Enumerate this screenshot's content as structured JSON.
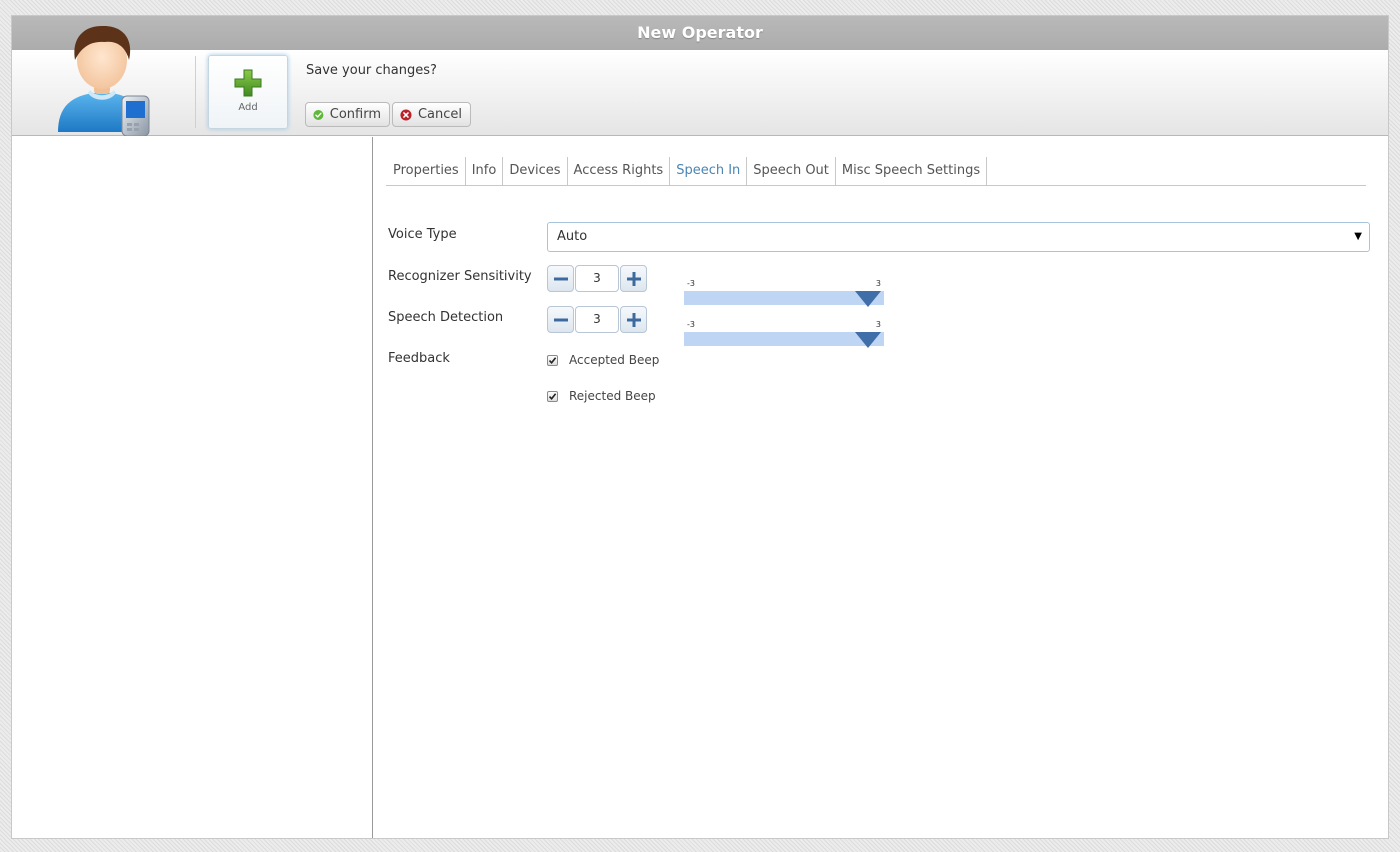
{
  "window": {
    "title": "New Operator"
  },
  "header": {
    "add_label": "Add",
    "prompt": "Save your changes?",
    "confirm_label": "Confirm",
    "cancel_label": "Cancel"
  },
  "tabs": [
    {
      "label": "Properties"
    },
    {
      "label": "Info"
    },
    {
      "label": "Devices"
    },
    {
      "label": "Access Rights"
    },
    {
      "label": "Speech In",
      "active": true
    },
    {
      "label": "Speech Out"
    },
    {
      "label": "Misc Speech Settings"
    }
  ],
  "form": {
    "voice_type": {
      "label": "Voice Type",
      "value": "Auto",
      "arrow": "▼"
    },
    "recognizer_sensitivity": {
      "label": "Recognizer Sensitivity",
      "value": "3",
      "min": "-3",
      "max": "3"
    },
    "speech_detection": {
      "label": "Speech Detection",
      "value": "3",
      "min": "-3",
      "max": "3"
    },
    "feedback": {
      "label": "Feedback",
      "options": [
        {
          "label": "Accepted Beep",
          "checked": true
        },
        {
          "label": "Rejected Beep",
          "checked": true
        }
      ]
    }
  },
  "icons": {
    "avatar": "operator-avatar-icon",
    "add": "plus-icon",
    "confirm": "check-circle-icon",
    "cancel": "x-circle-icon",
    "decrement": "minus-icon",
    "increment": "plus-icon",
    "checkbox": "check-icon",
    "dropdown": "triangle-down-icon"
  },
  "colors": {
    "accent": "#4a85b3",
    "slider_track": "#bed6f3",
    "slider_handle": "#3f6ea8",
    "add_green": "#4f9a2c"
  }
}
